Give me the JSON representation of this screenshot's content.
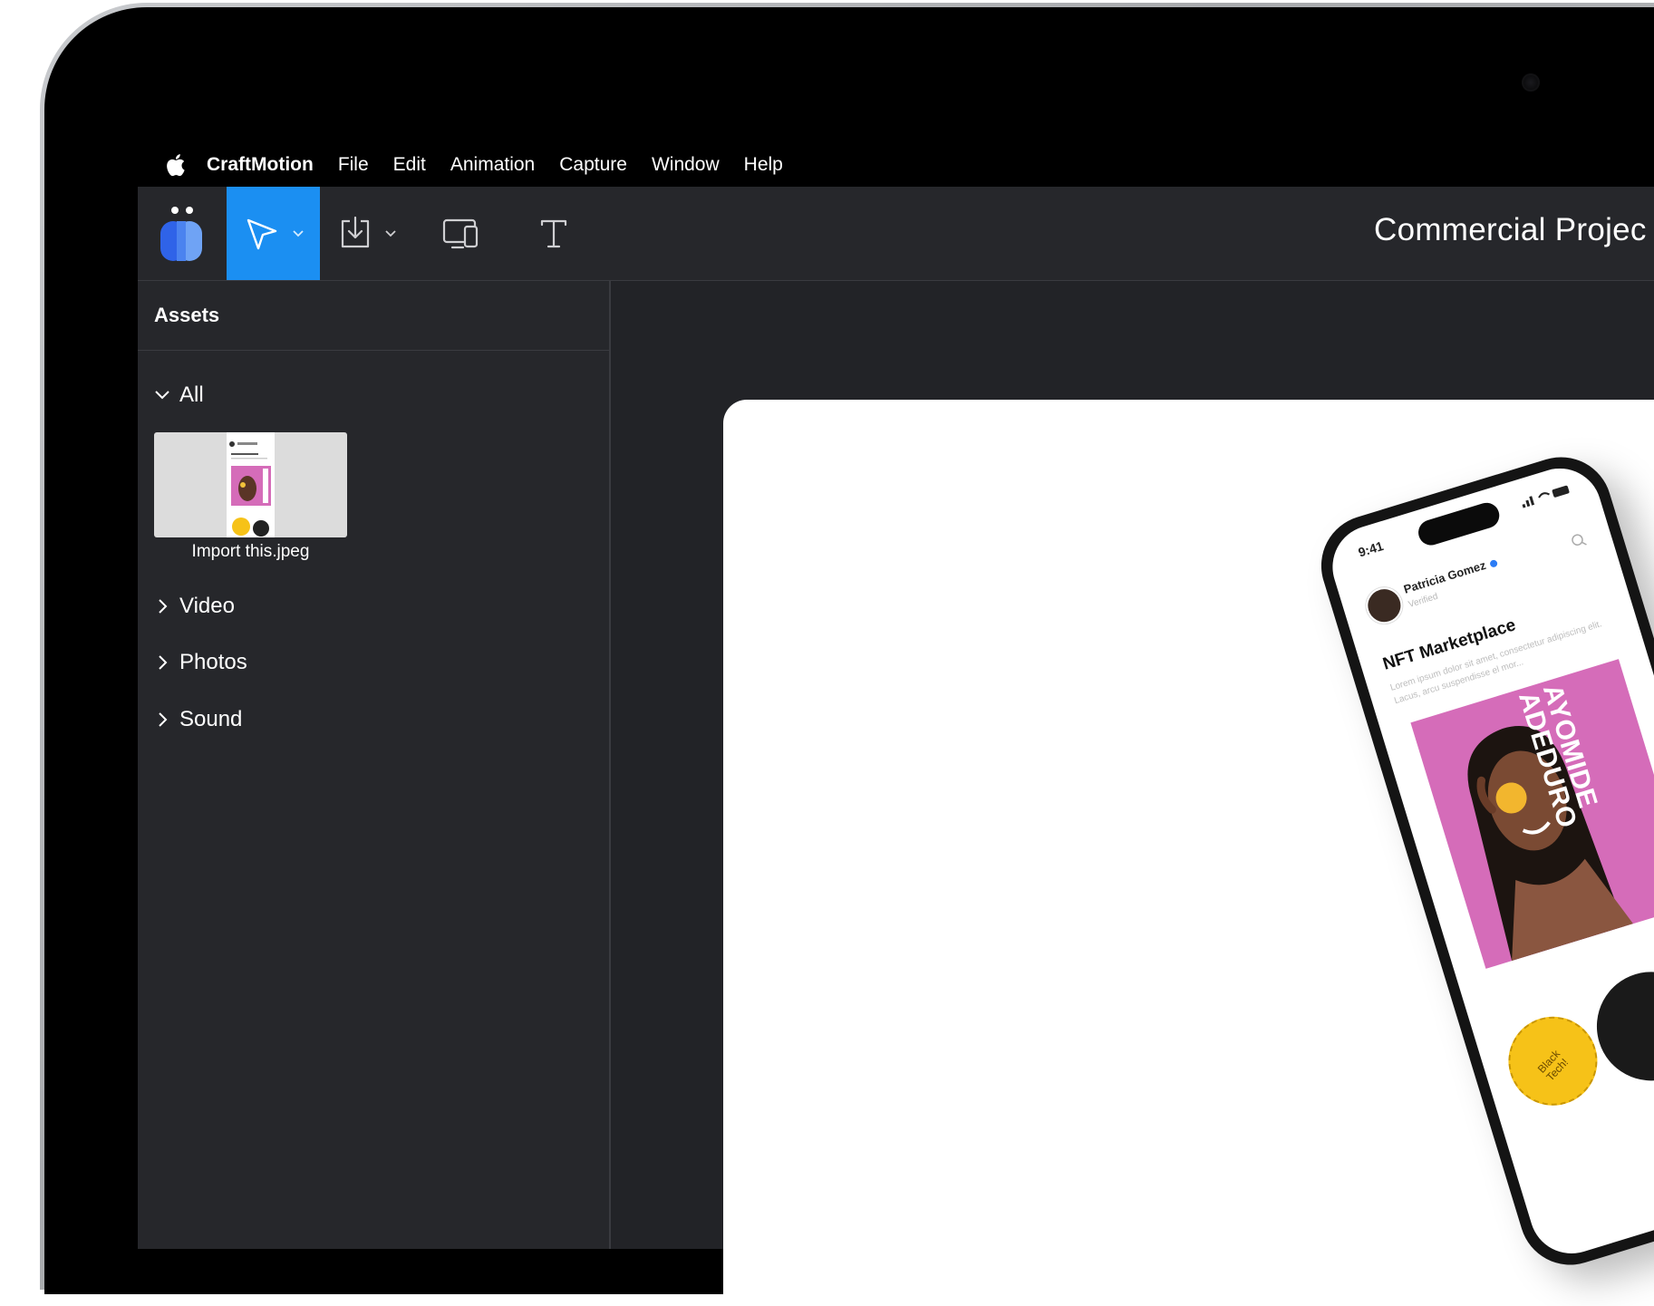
{
  "menubar": {
    "app_name": "CraftMotion",
    "items": [
      "File",
      "Edit",
      "Animation",
      "Capture",
      "Window",
      "Help"
    ]
  },
  "toolbar": {
    "tools": [
      "app-logo",
      "select-tool",
      "import-tool",
      "device-preview-tool",
      "text-tool"
    ],
    "active_tool": "select-tool",
    "accent_color": "#1b8ff2",
    "project_title": "Commercial Projec"
  },
  "sidebar": {
    "header": "Assets",
    "groups": {
      "all": {
        "label": "All",
        "expanded": true
      },
      "video": {
        "label": "Video",
        "expanded": false
      },
      "photos": {
        "label": "Photos",
        "expanded": false
      },
      "sound": {
        "label": "Sound",
        "expanded": false
      }
    },
    "asset": {
      "caption": "Import this.jpeg"
    }
  },
  "phone": {
    "time": "9:41",
    "user_name": "Patricia Gomez",
    "user_sub": "Verified",
    "title": "NFT Marketplace",
    "body": "Lorem ipsum dolor sit amet, consectetur adipiscing elit. Lacus, arcu suspendisse el mor...",
    "card_name_line1": "AYOMIDE",
    "card_name_line2": "ADEDURO",
    "badge_text": "Black Tech!"
  },
  "colors": {
    "app_bg": "#26272b",
    "canvas_bg": "#222327",
    "card_pink": "#d56cb9",
    "badge_yellow": "#f6c218"
  }
}
